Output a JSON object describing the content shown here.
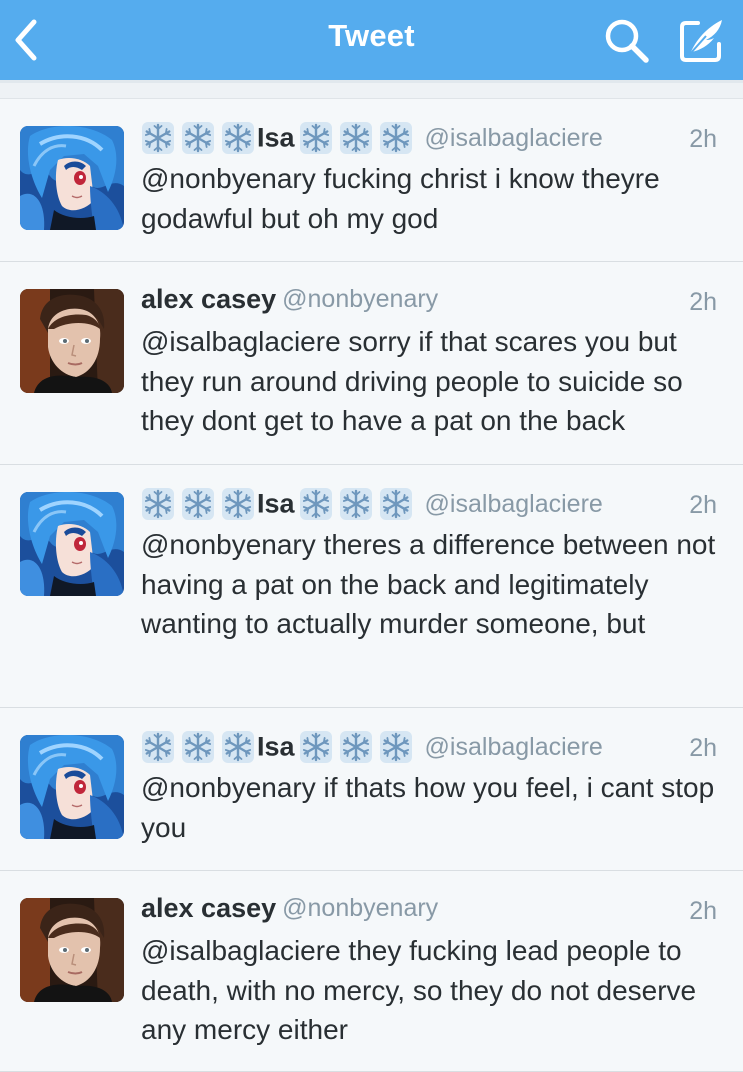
{
  "navbar": {
    "title": "Tweet",
    "back_icon": "chevron-left-icon",
    "search_icon": "search-icon",
    "compose_icon": "compose-tweet-icon",
    "background": "#55acee"
  },
  "tweets": [
    {
      "author": "isa",
      "name": "Isa",
      "handle": "@isalbaglaciere",
      "time": "2h",
      "text": "@nonbyenary fucking christ i know theyre godawful but oh my god",
      "decorations": "snowflake-emoji"
    },
    {
      "author": "alex",
      "name": "alex casey",
      "handle": "@nonbyenary",
      "time": "2h",
      "text": "@isalbaglaciere sorry if that scares you but they run around driving people to suicide so they dont get to have a pat on the back"
    },
    {
      "author": "isa",
      "name": "Isa",
      "handle": "@isalbaglaciere",
      "time": "2h",
      "text": "@nonbyenary theres a difference between not having a pat on the back and legitimately wanting to actually murder someone, but",
      "decorations": "snowflake-emoji"
    },
    {
      "author": "isa",
      "name": "Isa",
      "handle": "@isalbaglaciere",
      "time": "2h",
      "text": "@nonbyenary if thats how you feel, i cant stop you",
      "decorations": "snowflake-emoji"
    },
    {
      "author": "alex",
      "name": "alex casey",
      "handle": "@nonbyenary",
      "time": "2h",
      "text": "@isalbaglaciere they fucking lead people to death, with no mercy, so they do not deserve any mercy either"
    }
  ]
}
